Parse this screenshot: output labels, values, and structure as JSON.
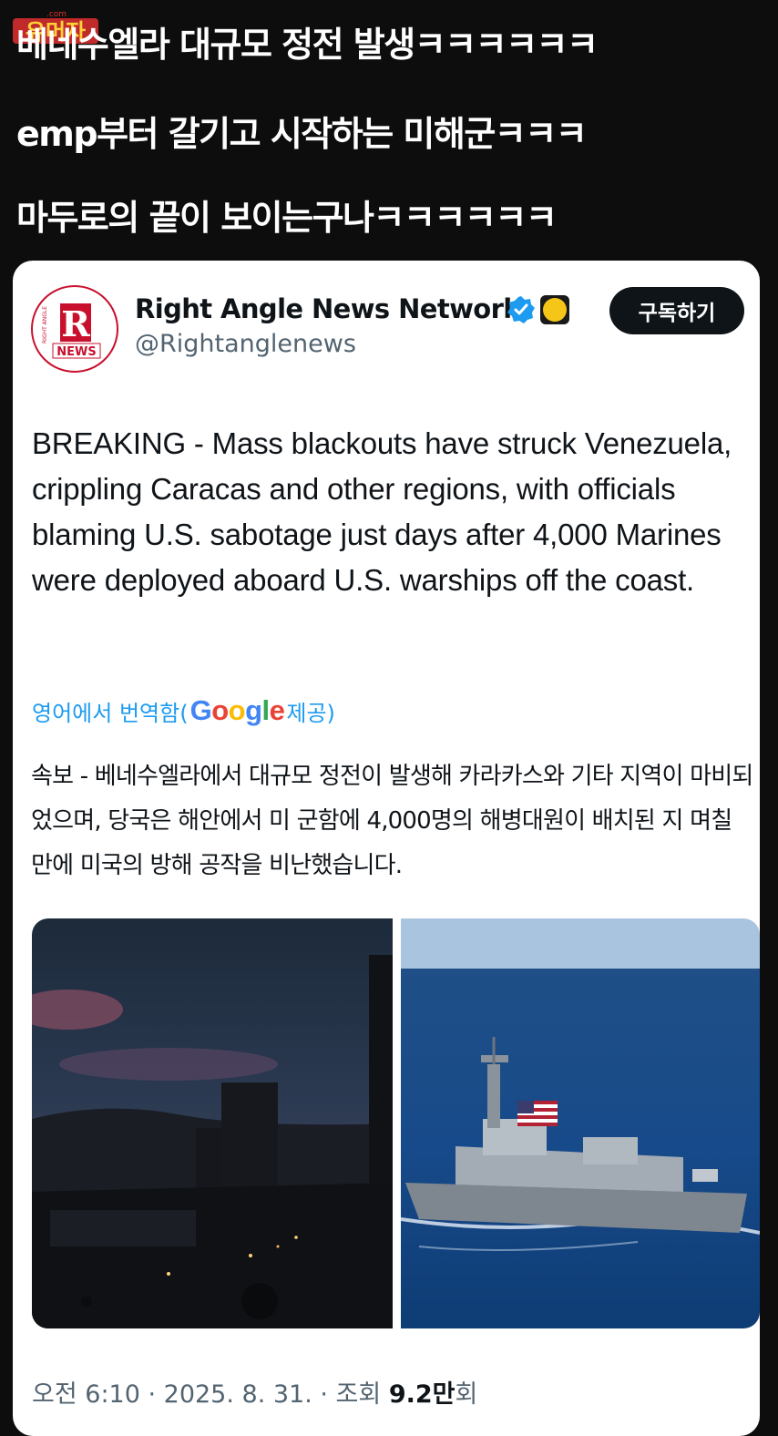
{
  "header": {
    "line1": "베네수엘라 대규모 정전 발생ㅋㅋㅋㅋㅋㅋ",
    "line2": "emp부터 갈기고 시작하는 미해군ㅋㅋㅋ",
    "line3": "마두로의 끝이 보이는구나ㅋㅋㅋㅋㅋㅋ"
  },
  "watermark": {
    "text": "유머자",
    "sub": ".com"
  },
  "tweet": {
    "display_name": "Right Angle News Network",
    "handle": "@Rightanglenews",
    "avatar_letter": "R",
    "avatar_top_text": "RIGHT ANGLE",
    "avatar_bottom_text": "NEWS",
    "subscribe_label": "구독하기",
    "body": "BREAKING - Mass blackouts have struck Venezuela, crippling Caracas and other regions, with officials blaming U.S. sabotage just days after 4,000 Marines were deployed aboard U.S. warships off the coast.",
    "translate_prefix": "영어에서 번역함(",
    "translate_brand": "Google",
    "translate_suffix": " 제공)",
    "translated_body": "속보 - 베네수엘라에서 대규모 정전이 발생해 카라카스와 기타 지역이 마비되었으며, 당국은 해안에서 미 군함에 4,000명의 해병대원이 배치된 지 며칠 만에 미국의 방해 공작을 비난했습니다.",
    "timestamp": "오전 6:10 · 2025. 8. 31. · 조회 ",
    "views_value": "9.2만",
    "views_suffix": "회"
  },
  "icons": {
    "verified": "verified-badge-icon",
    "emoji": "yellow-circle-emoji-icon"
  },
  "colors": {
    "background": "#0d0d0d",
    "link_blue": "#1d9bf0",
    "brand_red": "#c8102e",
    "text_primary": "#0f1419",
    "text_secondary": "#536471"
  }
}
